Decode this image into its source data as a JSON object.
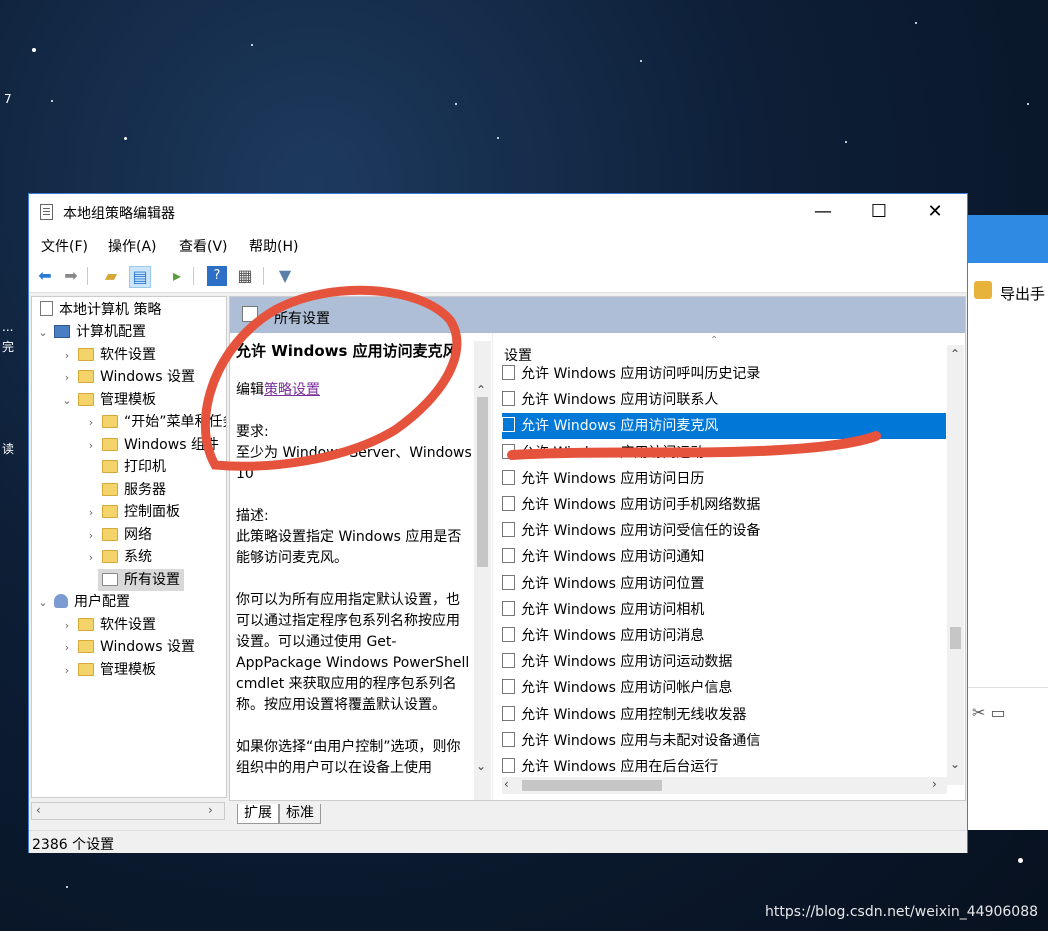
{
  "desktop": {
    "left_labels": [
      "7",
      "...",
      "完",
      "读"
    ],
    "watermark": "https://blog.csdn.net/weixin_44906088"
  },
  "bg_window": {
    "toolbar_label": "导出手"
  },
  "window": {
    "title": "本地组策略编辑器",
    "minimize": "—",
    "maximize": "☐",
    "close": "✕",
    "menu": [
      "文件(F)",
      "操作(A)",
      "查看(V)",
      "帮助(H)"
    ],
    "toolbar_icons": [
      "back-icon",
      "forward-icon",
      "up-folder-icon",
      "show-hide-tree-icon",
      "export-list-icon",
      "help-icon",
      "view-icon",
      "filter-icon"
    ]
  },
  "tree": {
    "root": "本地计算机 策略",
    "computer_config": "计算机配置",
    "cc_items": [
      "软件设置",
      "Windows 设置",
      "管理模板"
    ],
    "admin_items": [
      "“开始”菜单和任务栏",
      "Windows 组件",
      "打印机",
      "服务器",
      "控制面板",
      "网络",
      "系统",
      "所有设置"
    ],
    "user_config": "用户配置",
    "uc_items": [
      "软件设置",
      "Windows 设置",
      "管理模板"
    ]
  },
  "pane": {
    "header": "所有设置",
    "ext_title": "允许 Windows 应用访问麦克风",
    "edit_prefix": "编辑",
    "edit_link": "策略设置",
    "req_label": "要求:",
    "req_text": "至少为 Windows Server、Windows 10",
    "desc_label": "描述:",
    "desc_text": "此策略设置指定 Windows 应用是否能够访问麦克风。",
    "para2": "你可以为所有应用指定默认设置，也可以通过指定程序包系列名称按应用设置。可以通过使用 Get-AppPackage Windows PowerShell cmdlet 来获取应用的程序包系列名称。按应用设置将覆盖默认设置。",
    "para3": "如果你选择“由用户控制”选项，则你组织中的用户可以在设备上使用",
    "list_header": "设置",
    "rows": [
      "允许 Windows 应用访问呼叫历史记录",
      "允许 Windows 应用访问联系人",
      "允许 Windows 应用访问麦克风",
      "允许 Windows 应用访问运动",
      "允许 Windows 应用访问日历",
      "允许 Windows 应用访问手机网络数据",
      "允许 Windows 应用访问受信任的设备",
      "允许 Windows 应用访问通知",
      "允许 Windows 应用访问位置",
      "允许 Windows 应用访问相机",
      "允许 Windows 应用访问消息",
      "允许 Windows 应用访问运动数据",
      "允许 Windows 应用访问帐户信息",
      "允许 Windows 应用控制无线收发器",
      "允许 Windows 应用与未配对设备通信",
      "允许 Windows 应用在后台运行"
    ],
    "selected_index": 2,
    "tab_extended": "扩展",
    "tab_standard": "标准"
  },
  "status": "2386 个设置",
  "colors": {
    "selection": "#0078d7",
    "annotation": "#e5533d",
    "link": "#7b2f9b"
  }
}
